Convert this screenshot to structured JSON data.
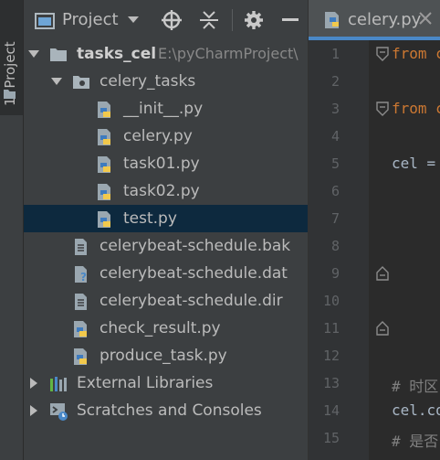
{
  "side_stripe": {
    "label": "1: Project"
  },
  "panel": {
    "title": "Project",
    "tree": [
      {
        "label": "tasks_cel",
        "path": "E:\\pyCharmProject\\",
        "bold": true,
        "indent": 0,
        "arrow": "open",
        "icon": "folder"
      },
      {
        "label": "celery_tasks",
        "indent": 1,
        "arrow": "open",
        "icon": "package-folder"
      },
      {
        "label": "__init__.py",
        "indent": 2,
        "icon": "python-file"
      },
      {
        "label": "celery.py",
        "indent": 2,
        "icon": "python-file"
      },
      {
        "label": "task01.py",
        "indent": 2,
        "icon": "python-file"
      },
      {
        "label": "task02.py",
        "indent": 2,
        "icon": "python-file"
      },
      {
        "label": "test.py",
        "indent": 2,
        "icon": "python-file",
        "selected": true
      },
      {
        "label": "celerybeat-schedule.bak",
        "indent": 1,
        "icon": "text-file"
      },
      {
        "label": "celerybeat-schedule.dat",
        "indent": 1,
        "icon": "unknown-file"
      },
      {
        "label": "celerybeat-schedule.dir",
        "indent": 1,
        "icon": "text-file"
      },
      {
        "label": "check_result.py",
        "indent": 1,
        "icon": "python-file"
      },
      {
        "label": "produce_task.py",
        "indent": 1,
        "icon": "python-file"
      },
      {
        "label": "External Libraries",
        "indent": 0,
        "arrow": "closed",
        "icon": "library"
      },
      {
        "label": "Scratches and Consoles",
        "indent": 0,
        "arrow": "closed",
        "icon": "scratches"
      }
    ]
  },
  "editor": {
    "tab_label": "celery.py",
    "line_numbers": [
      "1",
      "2",
      "3",
      "4",
      "5",
      "6",
      "7",
      "8",
      "9",
      "10",
      "11",
      "12",
      "13",
      "14",
      "15"
    ],
    "code_lines": [
      {
        "line": 1,
        "text": "from c",
        "color": "#cc7832"
      },
      {
        "line": 3,
        "text": "from c",
        "color": "#cc7832"
      },
      {
        "line": 5,
        "text": "cel = ",
        "color": "#a9b7c6"
      },
      {
        "line": 13,
        "text": "# 时区",
        "color": "#808080"
      },
      {
        "line": 14,
        "text": "cel.co",
        "color": "#a9b7c6"
      },
      {
        "line": 15,
        "text": "# 是否",
        "color": "#808080"
      }
    ]
  },
  "colors": {
    "panel_bg": "#3c3f41",
    "editor_bg": "#2b2b2b",
    "selection": "#0d293e",
    "keyword": "#cc7832",
    "comment": "#808080"
  }
}
